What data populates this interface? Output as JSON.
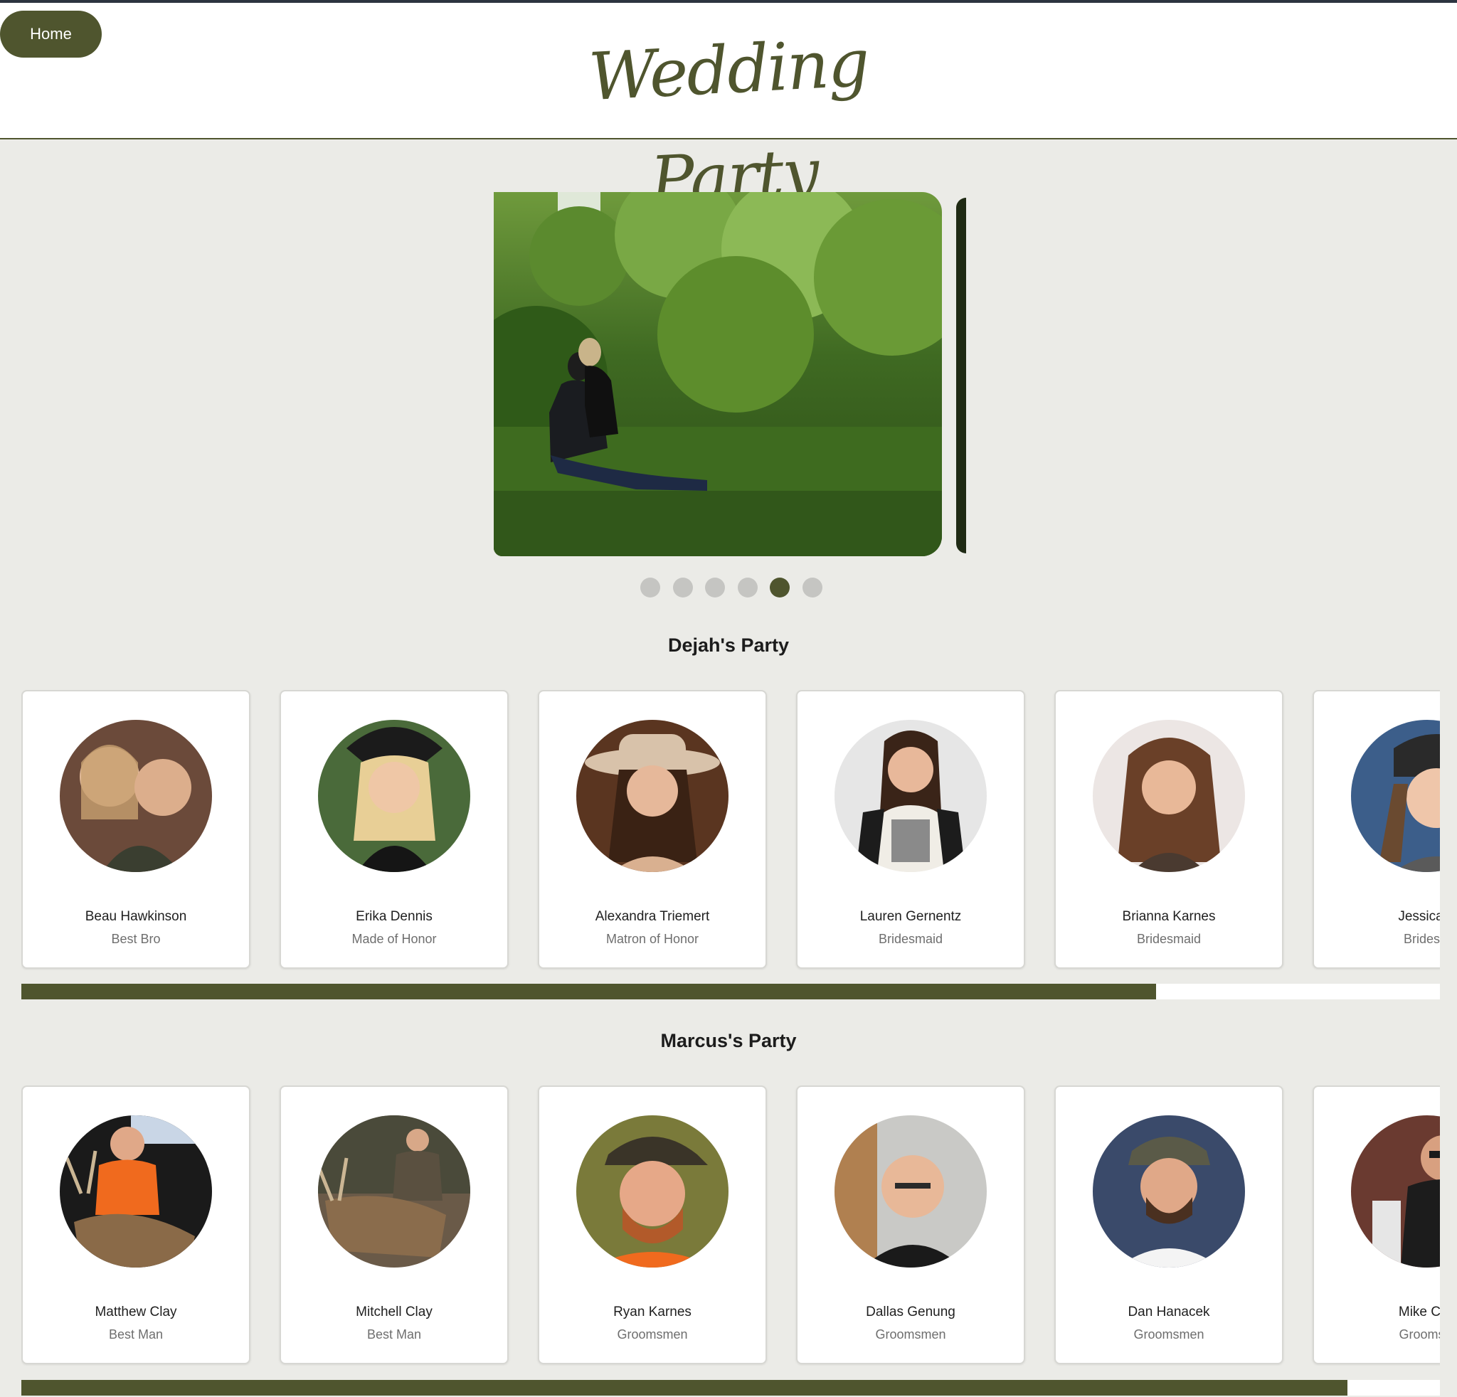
{
  "header": {
    "home_label": "Home",
    "title": "Wedding Party",
    "accent_color": "#4f552e"
  },
  "carousel": {
    "slide_count": 6,
    "active_index": 4,
    "image_description_icon": "photo-couple-in-forest"
  },
  "parties": [
    {
      "title": "Dejah's Party",
      "scroll_progress": 0.8,
      "members": [
        {
          "name": "Beau Hawkinson",
          "role": "Best Bro"
        },
        {
          "name": "Erika Dennis",
          "role": "Made of Honor"
        },
        {
          "name": "Alexandra Triemert",
          "role": "Matron of Honor"
        },
        {
          "name": "Lauren Gernentz",
          "role": "Bridesmaid"
        },
        {
          "name": "Brianna Karnes",
          "role": "Bridesmaid"
        },
        {
          "name": "Jessica B",
          "role": "Bridesm"
        }
      ]
    },
    {
      "title": "Marcus's Party",
      "scroll_progress": 0.935,
      "members": [
        {
          "name": "Matthew Clay",
          "role": "Best Man"
        },
        {
          "name": "Mitchell Clay",
          "role": "Best Man"
        },
        {
          "name": "Ryan Karnes",
          "role": "Groomsmen"
        },
        {
          "name": "Dallas Genung",
          "role": "Groomsmen"
        },
        {
          "name": "Dan Hanacek",
          "role": "Groomsmen"
        },
        {
          "name": "Mike Cha",
          "role": "Groomsm"
        }
      ]
    }
  ]
}
